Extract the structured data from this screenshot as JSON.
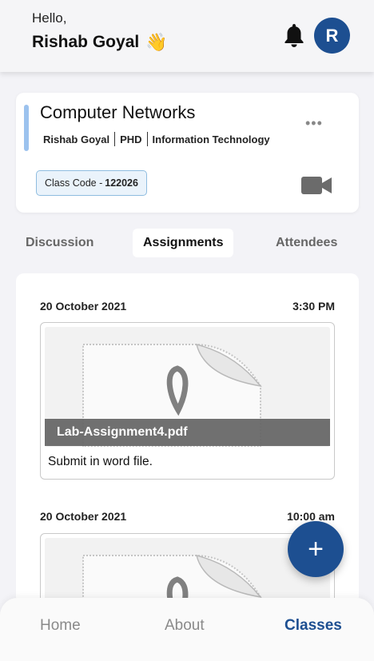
{
  "header": {
    "greeting": "Hello,",
    "user_name": "Rishab Goyal",
    "wave_emoji": "👋",
    "avatar_initial": "R",
    "bell_icon": "bell-icon",
    "accent_color": "#1d4f91"
  },
  "course": {
    "title": "Computer Networks",
    "instructor": "Rishab Goyal",
    "degree": "PHD",
    "department": "Information Technology",
    "class_code_label": "Class Code - ",
    "class_code_value": "122026",
    "more_label": "•••",
    "video_icon": "video-camera-icon"
  },
  "tabs": {
    "discussion": "Discussion",
    "assignments": "Assignments",
    "attendees": "Attendees",
    "active": "Assignments"
  },
  "assignments": [
    {
      "date": "20 October 2021",
      "time": "3:30 PM",
      "file_name": "Lab-Assignment4.pdf",
      "description": "Submit in word file."
    },
    {
      "date": "20 October 2021",
      "time": "10:00 am"
    }
  ],
  "fab": {
    "label": "+"
  },
  "nav": {
    "home": "Home",
    "about": "About",
    "classes": "Classes",
    "active": "Classes"
  }
}
